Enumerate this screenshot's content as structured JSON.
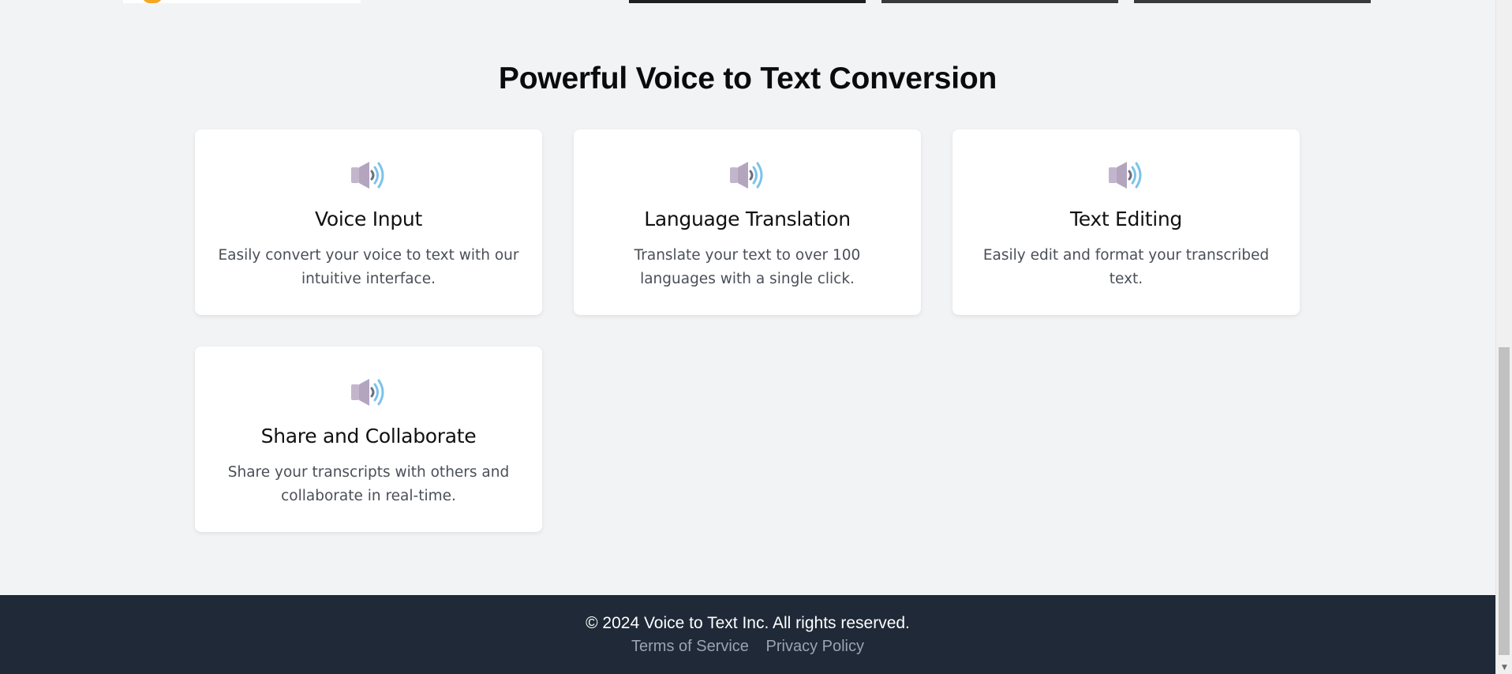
{
  "features": {
    "title": "Powerful Voice to Text Conversion",
    "cards": [
      {
        "icon": "speaker-icon",
        "title": "Voice Input",
        "description": "Easily convert your voice to text with our intuitive interface."
      },
      {
        "icon": "speaker-icon",
        "title": "Language Translation",
        "description": "Translate your text to over 100 languages with a single click."
      },
      {
        "icon": "speaker-icon",
        "title": "Text Editing",
        "description": "Easily edit and format your transcribed text."
      },
      {
        "icon": "speaker-icon",
        "title": "Share and Collaborate",
        "description": "Share your transcripts with others and collaborate in real-time."
      }
    ]
  },
  "footer": {
    "copyright": "© 2024 Voice to Text Inc. All rights reserved.",
    "links": [
      {
        "label": "Terms of Service"
      },
      {
        "label": "Privacy Policy"
      }
    ]
  },
  "colors": {
    "page_background": "#f2f3f5",
    "card_background": "#ffffff",
    "footer_background": "#1f2937",
    "footer_link": "#9ca3af",
    "speaker_body": "#c3b6cc",
    "sound_wave": "#7cc3ea"
  }
}
